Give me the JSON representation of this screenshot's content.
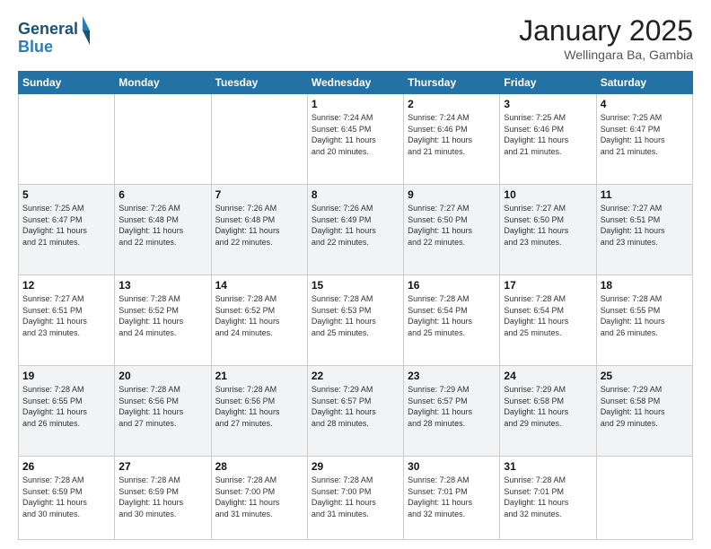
{
  "header": {
    "logo_line1": "General",
    "logo_line2": "Blue",
    "month": "January 2025",
    "location": "Wellingara Ba, Gambia"
  },
  "days_of_week": [
    "Sunday",
    "Monday",
    "Tuesday",
    "Wednesday",
    "Thursday",
    "Friday",
    "Saturday"
  ],
  "weeks": [
    [
      {
        "day": "",
        "info": ""
      },
      {
        "day": "",
        "info": ""
      },
      {
        "day": "",
        "info": ""
      },
      {
        "day": "1",
        "info": "Sunrise: 7:24 AM\nSunset: 6:45 PM\nDaylight: 11 hours\nand 20 minutes."
      },
      {
        "day": "2",
        "info": "Sunrise: 7:24 AM\nSunset: 6:46 PM\nDaylight: 11 hours\nand 21 minutes."
      },
      {
        "day": "3",
        "info": "Sunrise: 7:25 AM\nSunset: 6:46 PM\nDaylight: 11 hours\nand 21 minutes."
      },
      {
        "day": "4",
        "info": "Sunrise: 7:25 AM\nSunset: 6:47 PM\nDaylight: 11 hours\nand 21 minutes."
      }
    ],
    [
      {
        "day": "5",
        "info": "Sunrise: 7:25 AM\nSunset: 6:47 PM\nDaylight: 11 hours\nand 21 minutes."
      },
      {
        "day": "6",
        "info": "Sunrise: 7:26 AM\nSunset: 6:48 PM\nDaylight: 11 hours\nand 22 minutes."
      },
      {
        "day": "7",
        "info": "Sunrise: 7:26 AM\nSunset: 6:48 PM\nDaylight: 11 hours\nand 22 minutes."
      },
      {
        "day": "8",
        "info": "Sunrise: 7:26 AM\nSunset: 6:49 PM\nDaylight: 11 hours\nand 22 minutes."
      },
      {
        "day": "9",
        "info": "Sunrise: 7:27 AM\nSunset: 6:50 PM\nDaylight: 11 hours\nand 22 minutes."
      },
      {
        "day": "10",
        "info": "Sunrise: 7:27 AM\nSunset: 6:50 PM\nDaylight: 11 hours\nand 23 minutes."
      },
      {
        "day": "11",
        "info": "Sunrise: 7:27 AM\nSunset: 6:51 PM\nDaylight: 11 hours\nand 23 minutes."
      }
    ],
    [
      {
        "day": "12",
        "info": "Sunrise: 7:27 AM\nSunset: 6:51 PM\nDaylight: 11 hours\nand 23 minutes."
      },
      {
        "day": "13",
        "info": "Sunrise: 7:28 AM\nSunset: 6:52 PM\nDaylight: 11 hours\nand 24 minutes."
      },
      {
        "day": "14",
        "info": "Sunrise: 7:28 AM\nSunset: 6:52 PM\nDaylight: 11 hours\nand 24 minutes."
      },
      {
        "day": "15",
        "info": "Sunrise: 7:28 AM\nSunset: 6:53 PM\nDaylight: 11 hours\nand 25 minutes."
      },
      {
        "day": "16",
        "info": "Sunrise: 7:28 AM\nSunset: 6:54 PM\nDaylight: 11 hours\nand 25 minutes."
      },
      {
        "day": "17",
        "info": "Sunrise: 7:28 AM\nSunset: 6:54 PM\nDaylight: 11 hours\nand 25 minutes."
      },
      {
        "day": "18",
        "info": "Sunrise: 7:28 AM\nSunset: 6:55 PM\nDaylight: 11 hours\nand 26 minutes."
      }
    ],
    [
      {
        "day": "19",
        "info": "Sunrise: 7:28 AM\nSunset: 6:55 PM\nDaylight: 11 hours\nand 26 minutes."
      },
      {
        "day": "20",
        "info": "Sunrise: 7:28 AM\nSunset: 6:56 PM\nDaylight: 11 hours\nand 27 minutes."
      },
      {
        "day": "21",
        "info": "Sunrise: 7:28 AM\nSunset: 6:56 PM\nDaylight: 11 hours\nand 27 minutes."
      },
      {
        "day": "22",
        "info": "Sunrise: 7:29 AM\nSunset: 6:57 PM\nDaylight: 11 hours\nand 28 minutes."
      },
      {
        "day": "23",
        "info": "Sunrise: 7:29 AM\nSunset: 6:57 PM\nDaylight: 11 hours\nand 28 minutes."
      },
      {
        "day": "24",
        "info": "Sunrise: 7:29 AM\nSunset: 6:58 PM\nDaylight: 11 hours\nand 29 minutes."
      },
      {
        "day": "25",
        "info": "Sunrise: 7:29 AM\nSunset: 6:58 PM\nDaylight: 11 hours\nand 29 minutes."
      }
    ],
    [
      {
        "day": "26",
        "info": "Sunrise: 7:28 AM\nSunset: 6:59 PM\nDaylight: 11 hours\nand 30 minutes."
      },
      {
        "day": "27",
        "info": "Sunrise: 7:28 AM\nSunset: 6:59 PM\nDaylight: 11 hours\nand 30 minutes."
      },
      {
        "day": "28",
        "info": "Sunrise: 7:28 AM\nSunset: 7:00 PM\nDaylight: 11 hours\nand 31 minutes."
      },
      {
        "day": "29",
        "info": "Sunrise: 7:28 AM\nSunset: 7:00 PM\nDaylight: 11 hours\nand 31 minutes."
      },
      {
        "day": "30",
        "info": "Sunrise: 7:28 AM\nSunset: 7:01 PM\nDaylight: 11 hours\nand 32 minutes."
      },
      {
        "day": "31",
        "info": "Sunrise: 7:28 AM\nSunset: 7:01 PM\nDaylight: 11 hours\nand 32 minutes."
      },
      {
        "day": "",
        "info": ""
      }
    ]
  ]
}
